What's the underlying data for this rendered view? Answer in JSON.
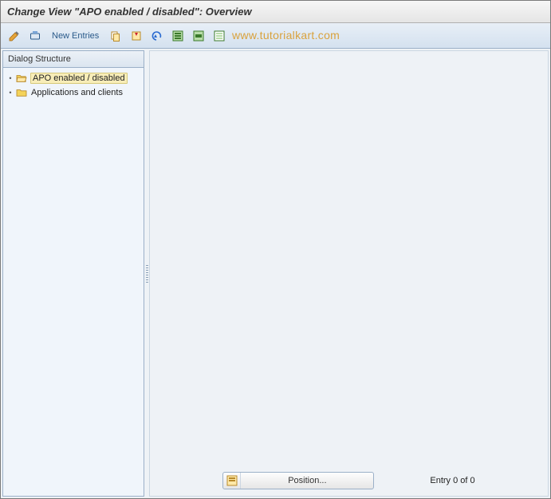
{
  "header": {
    "title": "Change View \"APO enabled / disabled\": Overview"
  },
  "toolbar": {
    "new_entries_label": "New Entries"
  },
  "sidebar": {
    "header": "Dialog Structure",
    "items": [
      {
        "label": "APO enabled / disabled",
        "selected": true,
        "open": true
      },
      {
        "label": "Applications and clients",
        "selected": false,
        "open": false
      }
    ]
  },
  "content": {
    "position_label": "Position...",
    "entry_status": "Entry 0 of 0"
  },
  "watermark": "www.tutorialkart.com"
}
